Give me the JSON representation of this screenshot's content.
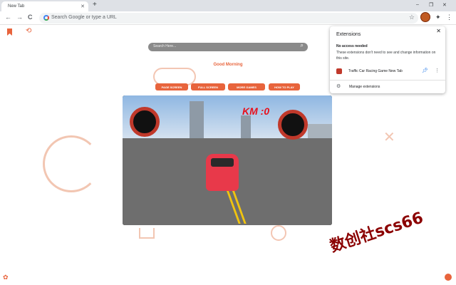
{
  "tab": {
    "title": "New Tab",
    "close": "✕"
  },
  "toolbar": {
    "new_tab": "+",
    "back": "←",
    "forward": "→",
    "reload": "C",
    "omnibox_placeholder": "Search Google or type a URL",
    "bookmark_star": "☆",
    "extensions_icon": "✦",
    "menu_icon": "⋮"
  },
  "window": {
    "minimize": "–",
    "maximize": "❐",
    "close": "✕"
  },
  "page": {
    "search_placeholder": "Search Here...",
    "greeting": "Good Morning",
    "buttons": [
      "PAGE SCREEN",
      "FULL SCREEN",
      "MORE GAMES",
      "HOW TO PLAY"
    ],
    "game": {
      "km": "KM :0"
    },
    "watermark": "数创社scs66"
  },
  "popup": {
    "title": "Extensions",
    "close": "✕",
    "section_heading": "No access needed",
    "section_desc": "These extensions don't need to see and change information on this site.",
    "extension_name": "Traffic Car Racing Game New Tab",
    "manage": "Manage extensions"
  },
  "colors": {
    "accent": "#e8643c",
    "popup_pin": "#1a73e8"
  }
}
